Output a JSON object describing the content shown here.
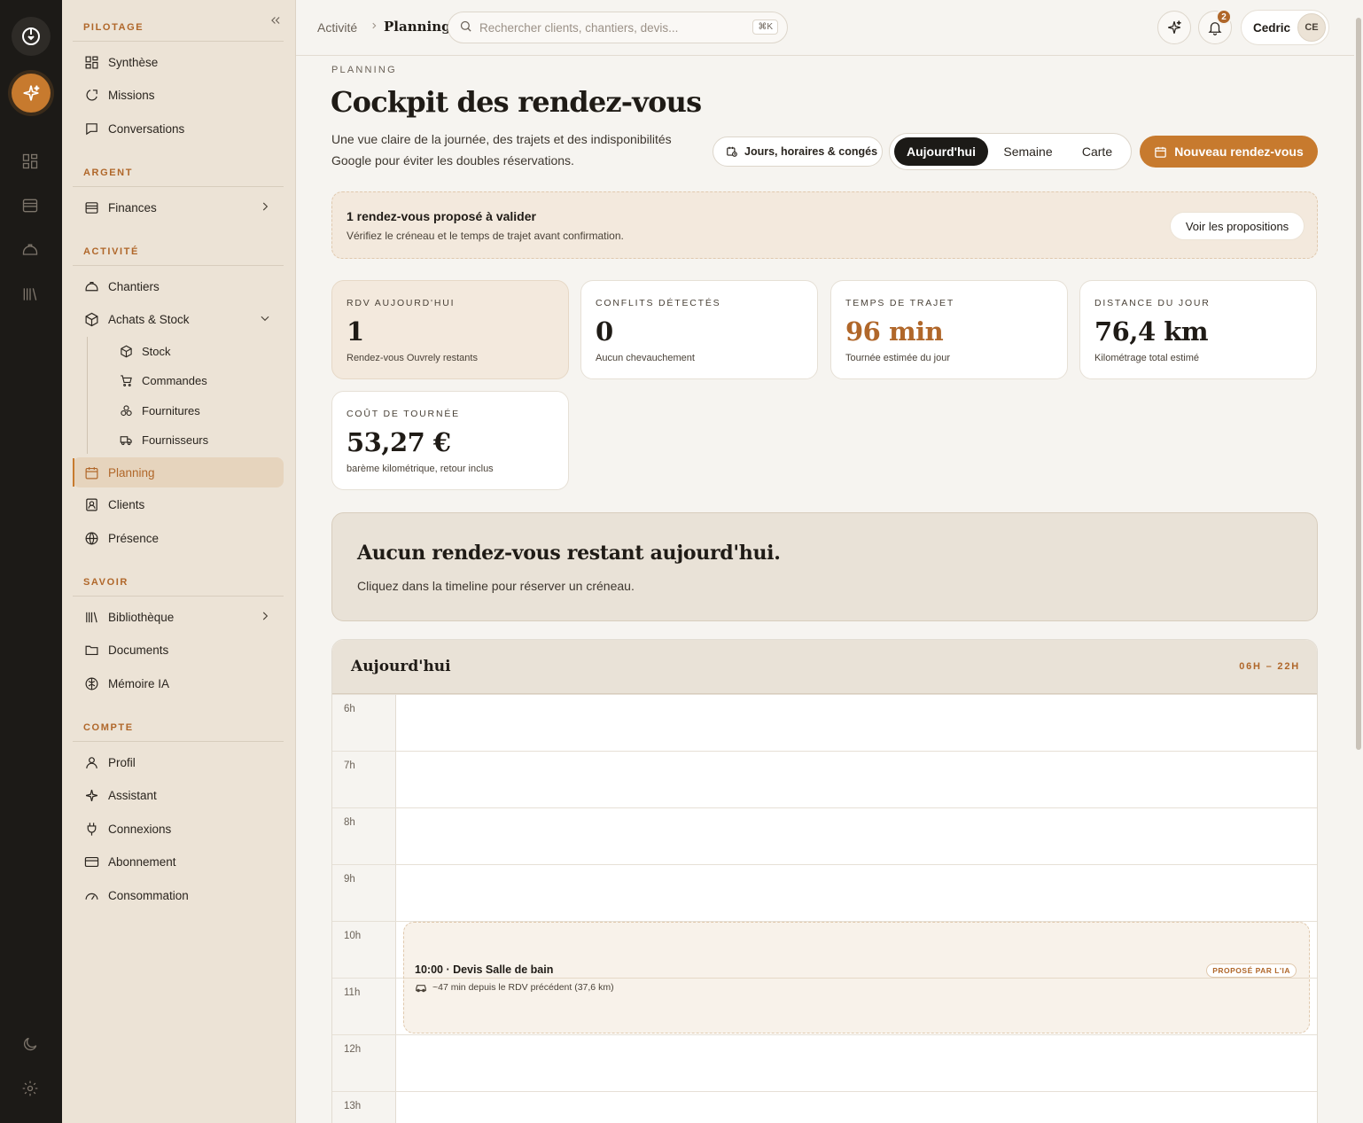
{
  "sidebar": {
    "sections": {
      "pilotage": "PILOTAGE",
      "argent": "ARGENT",
      "activite": "ACTIVITÉ",
      "savoir": "SAVOIR",
      "compte": "COMPTE"
    },
    "items": {
      "synthese": "Synthèse",
      "missions": "Missions",
      "conversations": "Conversations",
      "finances": "Finances",
      "chantiers": "Chantiers",
      "achats": "Achats & Stock",
      "stock": "Stock",
      "commandes": "Commandes",
      "fournitures": "Fournitures",
      "fournisseurs": "Fournisseurs",
      "planning": "Planning",
      "clients": "Clients",
      "presence": "Présence",
      "bibliotheque": "Bibliothèque",
      "documents": "Documents",
      "memoire": "Mémoire IA",
      "profil": "Profil",
      "assistant": "Assistant",
      "connexions": "Connexions",
      "abonnement": "Abonnement",
      "consommation": "Consommation"
    }
  },
  "topbar": {
    "breadcrumb_parent": "Activité",
    "breadcrumb_current": "Planning",
    "search_placeholder": "Rechercher clients, chantiers, devis...",
    "search_shortcut": "⌘K",
    "notification_count": "2",
    "user_name": "Cedric",
    "user_initials": "CE"
  },
  "header": {
    "overline": "PLANNING",
    "title": "Cockpit des rendez-vous",
    "description": "Une vue claire de la journée, des trajets et des indisponibilités Google pour éviter les doubles réservations.",
    "hours_button": "Jours, horaires & congés",
    "views": [
      "Aujourd'hui",
      "Semaine",
      "Carte"
    ],
    "active_view": "Aujourd'hui",
    "new_button": "Nouveau rendez-vous"
  },
  "proposal": {
    "title": "1 rendez-vous proposé à valider",
    "subtitle": "Vérifiez le créneau et le temps de trajet avant confirmation.",
    "button": "Voir les propositions"
  },
  "kpis": [
    {
      "label": "RDV AUJOURD'HUI",
      "value": "1",
      "sub": "Rendez-vous Ouvrely restants"
    },
    {
      "label": "CONFLITS DÉTECTÉS",
      "value": "0",
      "sub": "Aucun chevauchement"
    },
    {
      "label": "TEMPS DE TRAJET",
      "value": "96 min",
      "sub": "Tournée estimée du jour"
    },
    {
      "label": "DISTANCE DU JOUR",
      "value": "76,4 km",
      "sub": "Kilométrage total estimé"
    },
    {
      "label": "COÛT DE TOURNÉE",
      "value": "53,27 €",
      "sub": "barème kilométrique, retour inclus"
    }
  ],
  "empty_state": {
    "title": "Aucun rendez-vous restant aujourd'hui.",
    "subtitle": "Cliquez dans la timeline pour réserver un créneau."
  },
  "timeline": {
    "title": "Aujourd'hui",
    "range": "06H – 22H",
    "hours": [
      "6h",
      "7h",
      "8h",
      "9h",
      "10h",
      "11h",
      "12h",
      "13h"
    ],
    "event": {
      "title": "10:00 · Devis Salle de bain",
      "badge": "PROPOSÉ PAR L'IA",
      "travel": "~47 min depuis le RDV précédent (37,6 km)"
    }
  },
  "colors": {
    "accent": "#c77a2e",
    "accent_text": "#b0672a",
    "rail": "#1c1a17",
    "sidebar": "#ece3d6"
  }
}
